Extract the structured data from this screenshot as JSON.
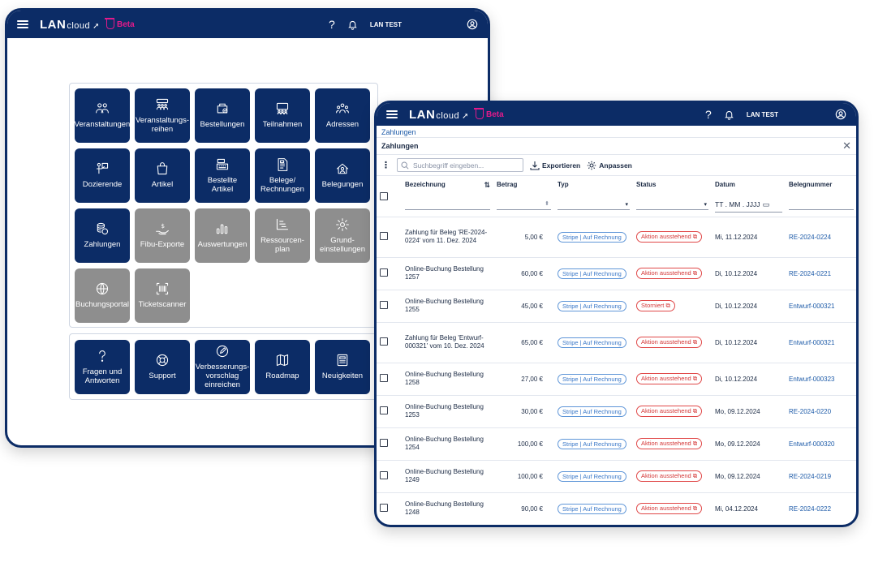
{
  "app": {
    "logo_main": "LAN",
    "logo_sub": "cloud",
    "beta": "Beta",
    "user": "LAN TEST",
    "help_icon": "help-icon",
    "bell_icon": "bell-icon",
    "account_icon": "account-icon"
  },
  "dashboard": {
    "tiles": [
      {
        "label": "Veranstaltungen",
        "icon": "people-group-icon"
      },
      {
        "label": "Veranstaltungs-\nreihen",
        "icon": "event-series-icon"
      },
      {
        "label": "Bestellungen",
        "icon": "order-icon"
      },
      {
        "label": "Teilnahmen",
        "icon": "participants-icon"
      },
      {
        "label": "Adressen",
        "icon": "addresses-icon"
      },
      {
        "label": "Dozierende",
        "icon": "lecturer-icon"
      },
      {
        "label": "Artikel",
        "icon": "bag-icon"
      },
      {
        "label": "Bestellte Artikel",
        "icon": "register-icon"
      },
      {
        "label": "Belege/\nRechnungen",
        "icon": "receipt-icon"
      },
      {
        "label": "Belegungen",
        "icon": "occupancy-icon"
      },
      {
        "label": "Zahlungen",
        "icon": "coins-icon"
      },
      {
        "label": "Fibu-Exporte",
        "icon": "money-hand-icon"
      },
      {
        "label": "Auswertungen",
        "icon": "bar-chart-icon"
      },
      {
        "label": "Ressourcen-plan",
        "icon": "resource-plan-icon"
      },
      {
        "label": "Grund-\neinstellungen",
        "icon": "gear-icon"
      },
      {
        "label": "Buchungsportal",
        "icon": "globe-icon"
      },
      {
        "label": "Ticketscanner",
        "icon": "barcode-icon"
      }
    ],
    "help_tiles": [
      {
        "label": "Fragen und\nAntworten",
        "icon": "question-icon"
      },
      {
        "label": "Support",
        "icon": "lifebuoy-icon"
      },
      {
        "label": "Verbesserungs-\nvorschlag\neinreichen",
        "icon": "pen-icon"
      },
      {
        "label": "Roadmap",
        "icon": "map-icon"
      },
      {
        "label": "Neuigkeiten",
        "icon": "newspaper-icon"
      }
    ]
  },
  "payments": {
    "breadcrumb": "Zahlungen",
    "title": "Zahlungen",
    "search_placeholder": "Suchbegriff eingeben...",
    "export_label": "Exportieren",
    "customize_label": "Anpassen",
    "columns": {
      "bezeichnung": "Bezeichnung",
      "betrag": "Betrag",
      "typ": "Typ",
      "status": "Status",
      "datum": "Datum",
      "belegnummer": "Belegnummer",
      "date_placeholder": "TT . MM . JJJJ"
    },
    "rows": [
      {
        "bezeichnung": "Zahlung für Beleg 'RE-2024-0224' vom 11. Dez. 2024",
        "betrag": "5,00 €",
        "typ": "Stripe | Auf Rechnung",
        "status": "Aktion ausstehend",
        "datum": "Mi, 11.12.2024",
        "beleg": "RE-2024-0224"
      },
      {
        "bezeichnung": "Online-Buchung Bestellung 1257",
        "betrag": "60,00 €",
        "typ": "Stripe | Auf Rechnung",
        "status": "Aktion ausstehend",
        "datum": "Di, 10.12.2024",
        "beleg": "RE-2024-0221"
      },
      {
        "bezeichnung": "Online-Buchung Bestellung 1255",
        "betrag": "45,00 €",
        "typ": "Stripe | Auf Rechnung",
        "status": "Storniert",
        "datum": "Di, 10.12.2024",
        "beleg": "Entwurf-000321"
      },
      {
        "bezeichnung": "Zahlung für Beleg 'Entwurf-000321' vom 10. Dez. 2024",
        "betrag": "65,00 €",
        "typ": "Stripe | Auf Rechnung",
        "status": "Aktion ausstehend",
        "datum": "Di, 10.12.2024",
        "beleg": "Entwurf-000321"
      },
      {
        "bezeichnung": "Online-Buchung Bestellung 1258",
        "betrag": "27,00 €",
        "typ": "Stripe | Auf Rechnung",
        "status": "Aktion ausstehend",
        "datum": "Di, 10.12.2024",
        "beleg": "Entwurf-000323"
      },
      {
        "bezeichnung": "Online-Buchung Bestellung 1253",
        "betrag": "30,00 €",
        "typ": "Stripe | Auf Rechnung",
        "status": "Aktion ausstehend",
        "datum": "Mo, 09.12.2024",
        "beleg": "RE-2024-0220"
      },
      {
        "bezeichnung": "Online-Buchung Bestellung 1254",
        "betrag": "100,00 €",
        "typ": "Stripe | Auf Rechnung",
        "status": "Aktion ausstehend",
        "datum": "Mo, 09.12.2024",
        "beleg": "Entwurf-000320"
      },
      {
        "bezeichnung": "Online-Buchung Bestellung 1249",
        "betrag": "100,00 €",
        "typ": "Stripe | Auf Rechnung",
        "status": "Aktion ausstehend",
        "datum": "Mo, 09.12.2024",
        "beleg": "RE-2024-0219"
      },
      {
        "bezeichnung": "Online-Buchung Bestellung 1248",
        "betrag": "90,00 €",
        "typ": "Stripe | Auf Rechnung",
        "status": "Aktion ausstehend",
        "datum": "Mi, 04.12.2024",
        "beleg": "RE-2024-0222"
      }
    ]
  }
}
